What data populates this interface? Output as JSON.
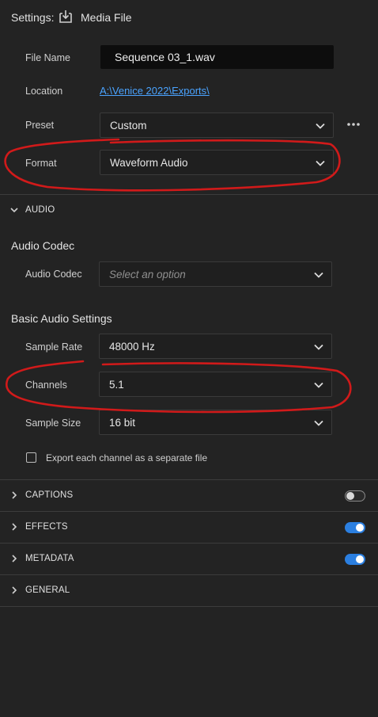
{
  "header": {
    "settings_label": "Settings:",
    "icon": "export-download-icon",
    "title": "Media File"
  },
  "fields": {
    "file_name": {
      "label": "File Name",
      "value": "Sequence 03_1.wav"
    },
    "location": {
      "label": "Location",
      "value": "A:\\Venice 2022\\Exports\\"
    },
    "preset": {
      "label": "Preset",
      "value": "Custom"
    },
    "format": {
      "label": "Format",
      "value": "Waveform Audio"
    }
  },
  "audio": {
    "section_label": "AUDIO",
    "codec_group": {
      "title": "Audio Codec",
      "codec_label": "Audio Codec",
      "codec_placeholder": "Select an option"
    },
    "basic_group": {
      "title": "Basic Audio Settings",
      "sample_rate": {
        "label": "Sample Rate",
        "value": "48000 Hz"
      },
      "channels": {
        "label": "Channels",
        "value": "5.1"
      },
      "sample_size": {
        "label": "Sample Size",
        "value": "16 bit"
      },
      "export_each_channel": {
        "label": "Export each channel as a separate file",
        "checked": false
      }
    }
  },
  "sections": [
    {
      "label": "CAPTIONS",
      "toggle": false
    },
    {
      "label": "EFFECTS",
      "toggle": true
    },
    {
      "label": "METADATA",
      "toggle": true
    },
    {
      "label": "GENERAL"
    }
  ],
  "colors": {
    "background": "#232323",
    "link": "#4aa3ff",
    "toggle_on": "#2b7fe0",
    "annotation": "#d11a1a"
  }
}
